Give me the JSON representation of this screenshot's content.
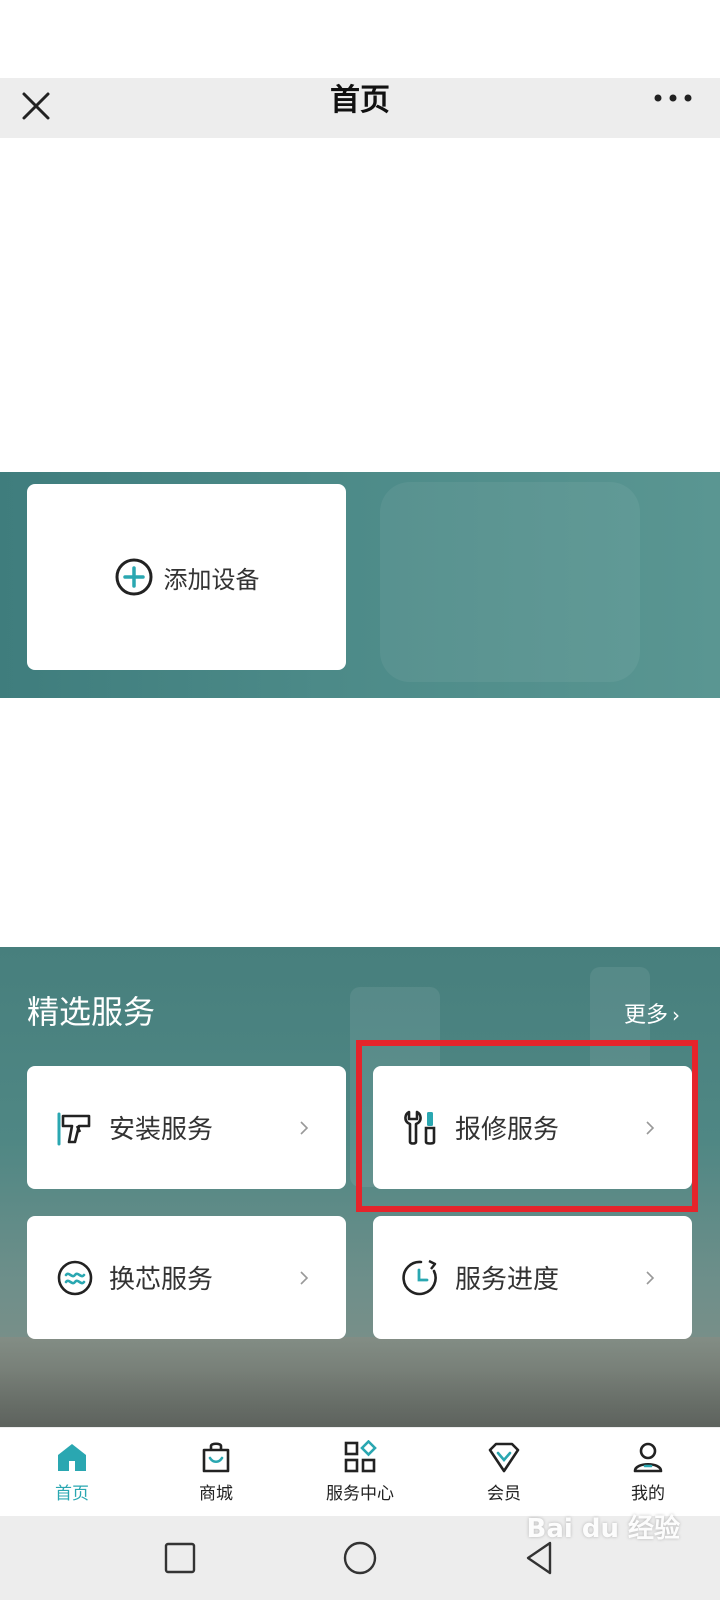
{
  "header": {
    "title": "首页"
  },
  "device": {
    "add_label": "添加设备"
  },
  "services": {
    "title": "精选服务",
    "more_label": "更多",
    "items": [
      {
        "label": "安装服务",
        "icon": "drill-icon"
      },
      {
        "label": "报修服务",
        "icon": "wrench-screwdriver-icon"
      },
      {
        "label": "换芯服务",
        "icon": "water-filter-icon"
      },
      {
        "label": "服务进度",
        "icon": "clock-progress-icon"
      }
    ]
  },
  "tabbar": {
    "items": [
      {
        "label": "首页",
        "icon": "home-icon",
        "active": true
      },
      {
        "label": "商城",
        "icon": "shopping-bag-icon",
        "active": false
      },
      {
        "label": "服务中心",
        "icon": "grid-apps-icon",
        "active": false
      },
      {
        "label": "会员",
        "icon": "diamond-icon",
        "active": false
      },
      {
        "label": "我的",
        "icon": "person-icon",
        "active": false
      }
    ]
  },
  "watermark": {
    "text": "Bai du 经验"
  },
  "colors": {
    "accent": "#2aa7b1",
    "banner_teal": "#4c8a88",
    "highlight_red": "#e5242b",
    "titlebar_bg": "#ededed"
  }
}
